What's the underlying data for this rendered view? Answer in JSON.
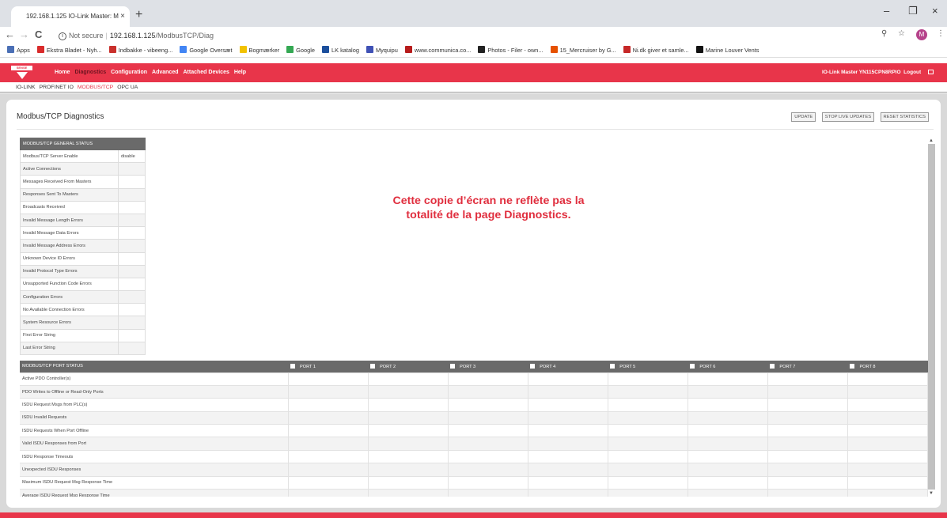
{
  "browser": {
    "tab_title": "192.168.1.125 IO-Link Master: M",
    "tab_close": "×",
    "new_tab": "+",
    "window_controls": [
      "–",
      "❐",
      "×"
    ],
    "nav": {
      "back": "←",
      "forward": "→",
      "reload": "C"
    },
    "security_label": "Not secure",
    "url_host": "192.168.1.125",
    "url_path": "/ModbusTCP/Diag",
    "avatar_letter": "M",
    "bookmarks": [
      {
        "label": "Apps",
        "color": "#4a6fb5"
      },
      {
        "label": "Ekstra Bladet - Nyh...",
        "color": "#d92b2b"
      },
      {
        "label": "Indbakke - vibeeng...",
        "color": "#c9302c"
      },
      {
        "label": "Google Oversæt",
        "color": "#4285f4"
      },
      {
        "label": "Bogmærker",
        "color": "#f2c200"
      },
      {
        "label": "Google",
        "color": "#34a853"
      },
      {
        "label": "LK katalog",
        "color": "#1c4f9c"
      },
      {
        "label": "Myquipu",
        "color": "#3f51b5"
      },
      {
        "label": "www.communica.co...",
        "color": "#b71c1c"
      },
      {
        "label": "Photos - Filer - own...",
        "color": "#222222"
      },
      {
        "label": "15_Mercruiser by G...",
        "color": "#e65100"
      },
      {
        "label": "Ni.dk giver et samle...",
        "color": "#c62828"
      },
      {
        "label": "Marine Louver Vents",
        "color": "#111111"
      }
    ]
  },
  "app": {
    "logo_text": "SENSE LINKED",
    "nav": [
      "Home",
      "Diagnostics",
      "Configuration",
      "Advanced",
      "Attached Devices",
      "Help"
    ],
    "active_nav": "Diagnostics",
    "device_label": "IO-Link Master YN115CPN8RPIO",
    "logout_label": "Logout",
    "subnav": [
      "IO-LINK",
      "PROFINET IO",
      "MODBUS/TCP",
      "OPC UA"
    ],
    "active_subnav": "MODBUS/TCP",
    "accent": "#e8354a"
  },
  "page": {
    "title": "Modbus/TCP Diagnostics",
    "buttons": {
      "update": "UPDATE",
      "stop": "STOP LIVE UPDATES",
      "reset": "RESET STATISTICS"
    },
    "note_line1": "Cette copie d’écran ne reflète pas la",
    "note_line2": "totalité de la page Diagnostics.",
    "general_status": {
      "header": "MODBUS/TCP GENERAL STATUS",
      "rows": [
        {
          "label": "Modbus/TCP Server Enable",
          "value": "disable"
        },
        {
          "label": "Active Connections",
          "value": ""
        },
        {
          "label": "Messages Received From Masters",
          "value": ""
        },
        {
          "label": "Responses Sent To Masters",
          "value": ""
        },
        {
          "label": "Broadcasts Received",
          "value": ""
        },
        {
          "label": "Invalid Message Length Errors",
          "value": ""
        },
        {
          "label": "Invalid Message Data Errors",
          "value": ""
        },
        {
          "label": "Invalid Message Address Errors",
          "value": ""
        },
        {
          "label": "Unknown Device ID Errors",
          "value": ""
        },
        {
          "label": "Invalid Protocol Type Errors",
          "value": ""
        },
        {
          "label": "Unsupported Function Code Errors",
          "value": ""
        },
        {
          "label": "Configuration Errors",
          "value": ""
        },
        {
          "label": "No Available Connection Errors",
          "value": ""
        },
        {
          "label": "System Resource Errors",
          "value": ""
        },
        {
          "label": "First Error String",
          "value": ""
        },
        {
          "label": "Last Error String",
          "value": ""
        }
      ]
    },
    "port_status": {
      "header": "MODBUS/TCP PORT STATUS",
      "ports": [
        "PORT 1",
        "PORT 2",
        "PORT 3",
        "PORT 4",
        "PORT 5",
        "PORT 6",
        "PORT 7",
        "PORT 8"
      ],
      "rows": [
        "Active PDO Controller(s)",
        "PDO Writes to Offline or Read-Only Ports",
        "ISDU Request Msgs from PLC(s)",
        "ISDU Invalid Requests",
        "ISDU Requests When Port Offline",
        "Valid ISDU Responses from Port",
        "ISDU Response Timeouts",
        "Unexpected ISDU Responses",
        "Maximum ISDU Request Msg Response Time",
        "Average ISDU Request Msg Response Time"
      ]
    }
  }
}
